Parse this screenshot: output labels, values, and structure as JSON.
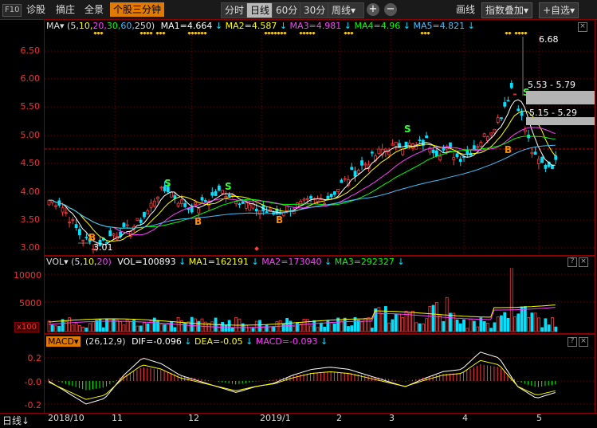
{
  "toolbar": {
    "f10": "F10",
    "diagnose": "诊股",
    "pick": "摘庄",
    "panorama": "全景",
    "stock_3min": "个股三分钟",
    "timeshare": "分时",
    "daily": "日线",
    "min60": "60分",
    "min30": "30分",
    "weekly": "周线",
    "weekly_arrow": "▾",
    "plus": "+",
    "minus": "−",
    "draw": "画线",
    "index_overlay": "指数叠加",
    "add_custom": "+自选"
  },
  "ma_panel": {
    "label": "MA",
    "params_prefix": "(5,",
    "p10": "10,",
    "p20": "20,",
    "p30": "30,",
    "p60": "60,",
    "p250": "250)",
    "ma1": "MA1=4.664",
    "ma2": "MA2=4.587",
    "ma3": "MA3=4.981",
    "ma4": "MA4=4.96",
    "ma5": "MA5=4.821",
    "y_ticks": [
      "6.50",
      "6.00",
      "5.50",
      "5.00",
      "4.50",
      "4.00",
      "3.50",
      "3.00"
    ],
    "annot_high": "6.68",
    "annot_low": "3.01",
    "range1": "5.53 - 5.79",
    "range2": "5.15 - 5.29",
    "signals_b": [
      "B",
      "B",
      "B",
      "B"
    ],
    "signals_s": [
      "S",
      "S",
      "S",
      "S",
      "S"
    ]
  },
  "vol_panel": {
    "label": "VOL",
    "params_prefix": "(5,",
    "p10": "10,",
    "p20": "20)",
    "vol": "VOL=100893",
    "ma1": "MA1=162191",
    "ma2": "MA2=173040",
    "ma3": "MA3=292327",
    "y_ticks": [
      "10000",
      "5000"
    ],
    "unit": "x100"
  },
  "macd_panel": {
    "label": "MACD",
    "params": "(26,12,9)",
    "dif": "DIF=-0.096",
    "dea": "DEA=-0.05",
    "macd": "MACD=-0.093",
    "y_ticks": [
      "0.2",
      "-0.0",
      "-0.2"
    ]
  },
  "footer": {
    "period": "日线",
    "x_labels": [
      "2018/10",
      "11",
      "12",
      "2019/1",
      "2",
      "3",
      "4",
      "5"
    ]
  },
  "colors": {
    "up": "#ff3b3b",
    "down": "#00e0ff",
    "ma5": "#ffffff",
    "ma10": "#ffff00",
    "ma20": "#ff40ff",
    "ma30": "#00ff00",
    "ma60": "#40c0ff",
    "grid": "#6b0000"
  }
}
